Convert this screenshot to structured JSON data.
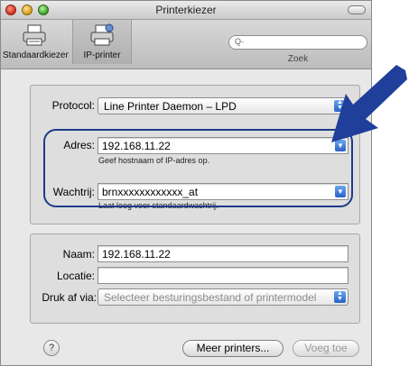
{
  "window": {
    "title": "Printerkiezer"
  },
  "toolbar": {
    "standard_label": "Standaardkiezer",
    "ip_label": "IP-printer",
    "search_placeholder": "Q-",
    "search_label": "Zoek"
  },
  "form": {
    "protocol_label": "Protocol:",
    "protocol_value": "Line Printer Daemon – LPD",
    "address_label": "Adres:",
    "address_value": "192.168.11.22",
    "address_hint": "Geef hostnaam of IP-adres op.",
    "queue_label": "Wachtrij:",
    "queue_value": "brnxxxxxxxxxxxx_at",
    "queue_hint": "Laat leeg voor standaardwachtrij.",
    "name_label": "Naam:",
    "name_value": "192.168.11.22",
    "location_label": "Locatie:",
    "location_value": "",
    "print_via_label": "Druk af via:",
    "print_via_value": "Selecteer besturingsbestand of printermodel"
  },
  "footer": {
    "help_label": "?",
    "more_printers_label": "Meer printers...",
    "add_label": "Voeg toe"
  },
  "colors": {
    "highlight": "#1c3b8a",
    "arrow": "#1f3f9a",
    "accent": "#2a63c6"
  }
}
